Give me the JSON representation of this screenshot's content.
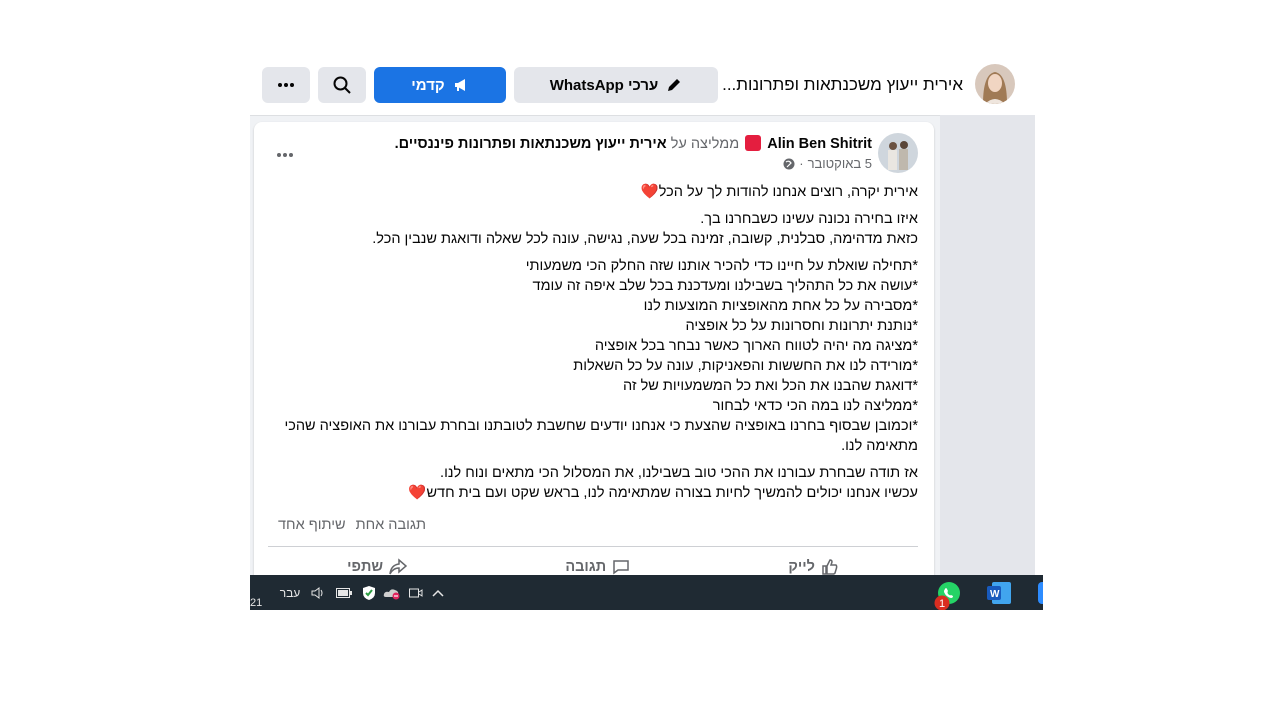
{
  "header": {
    "page_name": "אירית ייעוץ משכנתאות ופתרונות...",
    "whatsapp_label": "ערכי WhatsApp",
    "boost_label": "קדמי",
    "search_icon": "search-icon",
    "more_icon": "more-icon"
  },
  "post": {
    "author": "Alin Ben Shitrit",
    "recommends_text": "ממליצה על",
    "page_name": "אירית ייעוץ משכנתאות ופתרונות פיננסיים",
    "date": "5 באוקטובר",
    "separator": "·",
    "audience_icon": "globe-icon",
    "paragraphs": [
      "אירית יקרה, רוצים אנחנו להודות לך על הכל❤️",
      "איזו בחירה נכונה עשינו כשבחרנו בך.\nכזאת מדהימה, סבלנית, קשובה, זמינה בכל שעה, נגישה, עונה לכל שאלה ודואגת שנבין הכל.",
      "*תחילה שואלת על חיינו כדי להכיר אותנו שזה החלק הכי משמעותי\n*עושה את כל התהליך בשבילנו ומעדכנת בכל שלב איפה זה עומד\n*מסבירה על כל אחת מהאופציות המוצעות לנו\n*נותנת יתרונות וחסרונות על כל אופציה\n*מציגה מה יהיה לטווח הארוך כאשר נבחר בכל אופציה\n*מורידה לנו את החששות והפאניקות, עונה על כל השאלות\n*דואגת שהבנו את הכל ואת כל המשמעויות של זה\n*ממליצה לנו במה הכי כדאי לבחור\n*וכמובן שבסוף בחרנו באופציה שהצעת כי אנחנו יודעים שחשבת לטובתנו ובחרת עבורנו את האופציה שהכי מתאימה לנו.",
      "אז תודה שבחרת עבורנו את ההכי טוב בשבילנו, את המסלול הכי מתאים ונוח לנו.\nעכשיו אנחנו יכולים להמשיך לחיות בצורה שמתאימה לנו, בראש שקט ועם בית חדש❤️"
    ],
    "comments_count": "תגובה אחת",
    "shares_count": "שיתוף אחד",
    "actions": {
      "like": "לייק",
      "comment": "תגובה",
      "share": "שתפי"
    }
  },
  "taskbar": {
    "clock_partial": "21",
    "language": "עבר",
    "whatsapp_badge": "1",
    "apps": [
      "whatsapp-icon",
      "word-icon",
      "zoom-icon"
    ]
  },
  "colors": {
    "primary_blue": "#1b74e4",
    "taskbar": "#1f2a33",
    "background": "#f0f2f5"
  }
}
